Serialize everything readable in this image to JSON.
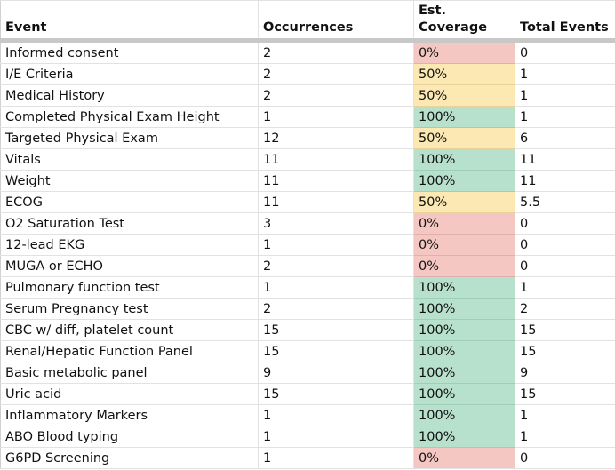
{
  "table": {
    "headers": {
      "event": "Event",
      "occurrences": "Occurrences",
      "coverage_line1": "Est.",
      "coverage_line2": "Coverage",
      "total": "Total Events"
    },
    "coverage_colors": {
      "red": "#f4c7c3",
      "yellow": "#fce8b2",
      "green": "#b7e1cd"
    },
    "rows": [
      {
        "event": "Informed consent",
        "occurrences": "2",
        "coverage": "0%",
        "total": "0",
        "level": "red"
      },
      {
        "event": "I/E Criteria",
        "occurrences": "2",
        "coverage": "50%",
        "total": "1",
        "level": "yellow"
      },
      {
        "event": "Medical History",
        "occurrences": "2",
        "coverage": "50%",
        "total": "1",
        "level": "yellow"
      },
      {
        "event": "Completed Physical Exam Height",
        "occurrences": "1",
        "coverage": "100%",
        "total": "1",
        "level": "green"
      },
      {
        "event": "Targeted Physical Exam",
        "occurrences": "12",
        "coverage": "50%",
        "total": "6",
        "level": "yellow"
      },
      {
        "event": "Vitals",
        "occurrences": "11",
        "coverage": "100%",
        "total": "11",
        "level": "green"
      },
      {
        "event": "Weight",
        "occurrences": "11",
        "coverage": "100%",
        "total": "11",
        "level": "green"
      },
      {
        "event": "ECOG",
        "occurrences": "11",
        "coverage": "50%",
        "total": "5.5",
        "level": "yellow"
      },
      {
        "event": "O2 Saturation Test",
        "occurrences": "3",
        "coverage": "0%",
        "total": "0",
        "level": "red"
      },
      {
        "event": "12-lead EKG",
        "occurrences": "1",
        "coverage": "0%",
        "total": "0",
        "level": "red"
      },
      {
        "event": "MUGA or ECHO",
        "occurrences": "2",
        "coverage": "0%",
        "total": "0",
        "level": "red"
      },
      {
        "event": "Pulmonary function test",
        "occurrences": "1",
        "coverage": "100%",
        "total": "1",
        "level": "green"
      },
      {
        "event": "Serum Pregnancy test",
        "occurrences": "2",
        "coverage": "100%",
        "total": "2",
        "level": "green"
      },
      {
        "event": "CBC w/ diff, platelet count",
        "occurrences": "15",
        "coverage": "100%",
        "total": "15",
        "level": "green"
      },
      {
        "event": "Renal/Hepatic Function Panel",
        "occurrences": "15",
        "coverage": "100%",
        "total": "15",
        "level": "green"
      },
      {
        "event": "Basic metabolic panel",
        "occurrences": "9",
        "coverage": "100%",
        "total": "9",
        "level": "green"
      },
      {
        "event": "Uric acid",
        "occurrences": "15",
        "coverage": "100%",
        "total": "15",
        "level": "green"
      },
      {
        "event": "Inflammatory Markers",
        "occurrences": "1",
        "coverage": "100%",
        "total": "1",
        "level": "green"
      },
      {
        "event": "ABO Blood typing",
        "occurrences": "1",
        "coverage": "100%",
        "total": "1",
        "level": "green"
      },
      {
        "event": "G6PD Screening",
        "occurrences": "1",
        "coverage": "0%",
        "total": "0",
        "level": "red"
      }
    ]
  }
}
